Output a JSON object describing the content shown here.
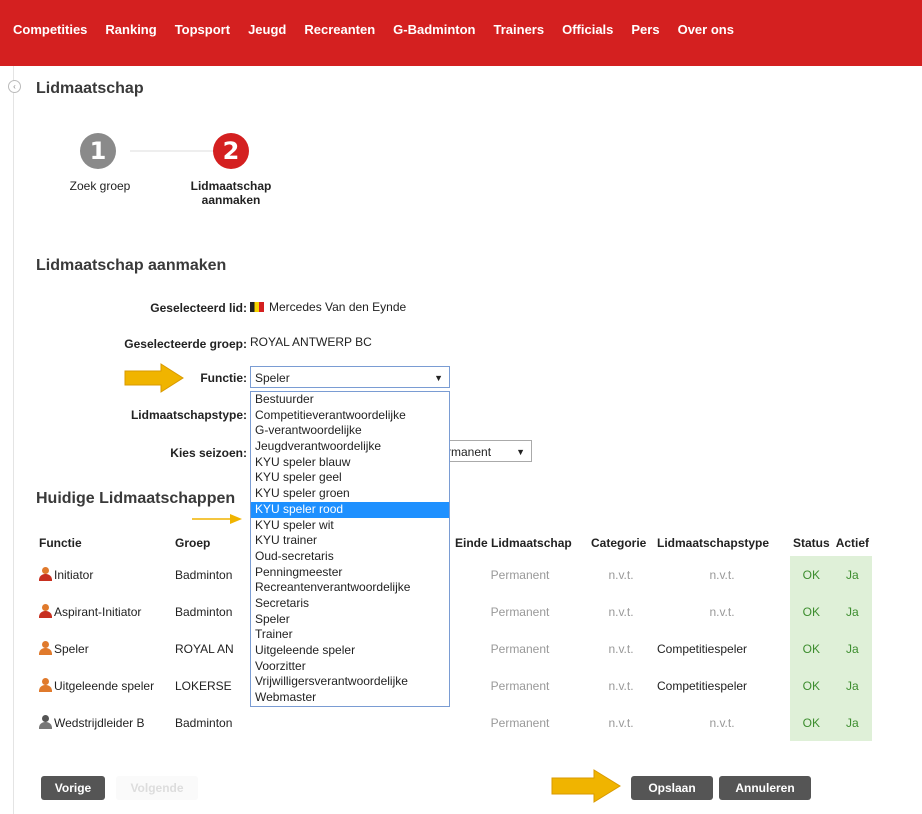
{
  "nav": [
    "Competities",
    "Ranking",
    "Topsport",
    "Jeugd",
    "Recreanten",
    "G-Badminton",
    "Trainers",
    "Officials",
    "Pers",
    "Over ons"
  ],
  "page_title": "Lidmaatschap",
  "steps": [
    {
      "number": "1",
      "label": "Zoek groep"
    },
    {
      "number": "2",
      "label": "Lidmaatschap aanmaken"
    }
  ],
  "form": {
    "heading": "Lidmaatschap aanmaken",
    "member_label": "Geselecteerd lid:",
    "member_value": "Mercedes Van den Eynde",
    "group_label": "Geselecteerde groep:",
    "group_value": "ROYAL ANTWERP BC",
    "function_label": "Functie:",
    "function_value": "Speler",
    "type_label": "Lidmaatschapstype:",
    "season_label": "Kies seizoen:",
    "season_value": "rmanent",
    "function_options": [
      "Bestuurder",
      "Competitieverantwoordelijke",
      "G-verantwoordelijke",
      "Jeugdverantwoordelijke",
      "KYU speler blauw",
      "KYU speler geel",
      "KYU speler groen",
      "KYU speler rood",
      "KYU speler wit",
      "KYU trainer",
      "Oud-secretaris",
      "Penningmeester",
      "Recreantenverantwoordelijke",
      "Secretaris",
      "Speler",
      "Trainer",
      "Uitgeleende speler",
      "Voorzitter",
      "Vrijwilligersverantwoordelijke",
      "Webmaster"
    ],
    "highlighted_option": "KYU speler rood"
  },
  "current": {
    "heading": "Huidige Lidmaatschappen",
    "columns": [
      "Functie",
      "Groep",
      "",
      "Einde Lidmaatschap",
      "Categorie",
      "Lidmaatschapstype",
      "Status",
      "Actief"
    ],
    "rows": [
      {
        "functie": "Initiator",
        "groep": "Badminton",
        "einde": "Permanent",
        "categorie": "n.v.t.",
        "type": "n.v.t.",
        "status": "OK",
        "actief": "Ja",
        "icon": "person-red-icon"
      },
      {
        "functie": "Aspirant-Initiator",
        "groep": "Badminton",
        "einde": "Permanent",
        "categorie": "n.v.t.",
        "type": "n.v.t.",
        "status": "OK",
        "actief": "Ja",
        "icon": "person-red-icon"
      },
      {
        "functie": "Speler",
        "groep": "ROYAL AN",
        "einde": "Permanent",
        "categorie": "n.v.t.",
        "type": "Competitiespeler",
        "status": "OK",
        "actief": "Ja",
        "icon": "person-orange-icon"
      },
      {
        "functie": "Uitgeleende speler",
        "groep": "LOKERSE",
        "einde": "Permanent",
        "categorie": "n.v.t.",
        "type": "Competitiespeler",
        "status": "OK",
        "actief": "Ja",
        "icon": "person-orange-icon"
      },
      {
        "functie": "Wedstrijdleider B",
        "groep": "Badminton",
        "einde": "Permanent",
        "categorie": "n.v.t.",
        "type": "n.v.t.",
        "status": "OK",
        "actief": "Ja",
        "icon": "person-gray-icon"
      }
    ]
  },
  "buttons": {
    "prev": "Vorige",
    "next": "Volgende",
    "save": "Opslaan",
    "cancel": "Annuleren"
  },
  "colors": {
    "brand": "#d42020",
    "highlight": "#1e90ff",
    "arrow": "#f0b400",
    "ok_bg": "#dff0d8"
  }
}
